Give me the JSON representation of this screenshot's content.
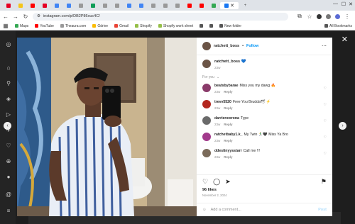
{
  "browser": {
    "url": "instagram.com/p/DB2P86xuc4C/",
    "bookmarks": [
      "Maps",
      "YouTube",
      "Theaura.com",
      "Gdrive",
      "Gmail",
      "Shopify",
      "Shopify work sheet",
      "",
      "",
      "New folder"
    ],
    "all_bookmarks": "All Bookmarks",
    "tab_colors": [
      "#e60023",
      "#f5c518",
      "#ff0000",
      "#e60023",
      "#4285f4",
      "#4285f4",
      "#999999",
      "#0f9d58",
      "#999999",
      "#999999",
      "#4285f4",
      "#4285f4",
      "#999999",
      "#999999",
      "#999999",
      "#ff0000",
      "#ff0000",
      "#34a853",
      "#1877f2"
    ]
  },
  "post": {
    "username": "ratchett_boss",
    "dot": "•",
    "follow_label": "Follow",
    "caption_text": "💙",
    "caption_age": "23w",
    "for_you": "For you",
    "likes": "96 likes",
    "date": "November 2, 2024",
    "add_comment_placeholder": "Add a comment...",
    "post_label": "Post"
  },
  "comments": [
    {
      "user": "beatsbybarae",
      "text": "Miss you my dawg 🔥",
      "age": "23w",
      "reply": "Reply",
      "avatar_color": "#8a3b6a"
    },
    {
      "user": "trevv5520",
      "text": "Free You Brudda🕊 ⚡",
      "age": "23w",
      "reply": "Reply",
      "avatar_color": "#b3261e"
    },
    {
      "user": "darriencorona",
      "text": "Type",
      "age": "23w",
      "reply": "Reply",
      "avatar_color": "#6a6a6a"
    },
    {
      "user": "ratchetbaby1.k_",
      "text": "My Twin 🏃‍♂️🖤 Miss Ya Bro",
      "age": "23w",
      "reply": "Reply",
      "avatar_color": "#a23a8c"
    },
    {
      "user": "ddestinyysstarr",
      "text": "Call me !!!",
      "age": "23w",
      "reply": "Reply",
      "avatar_color": "#7a6a5a"
    }
  ]
}
